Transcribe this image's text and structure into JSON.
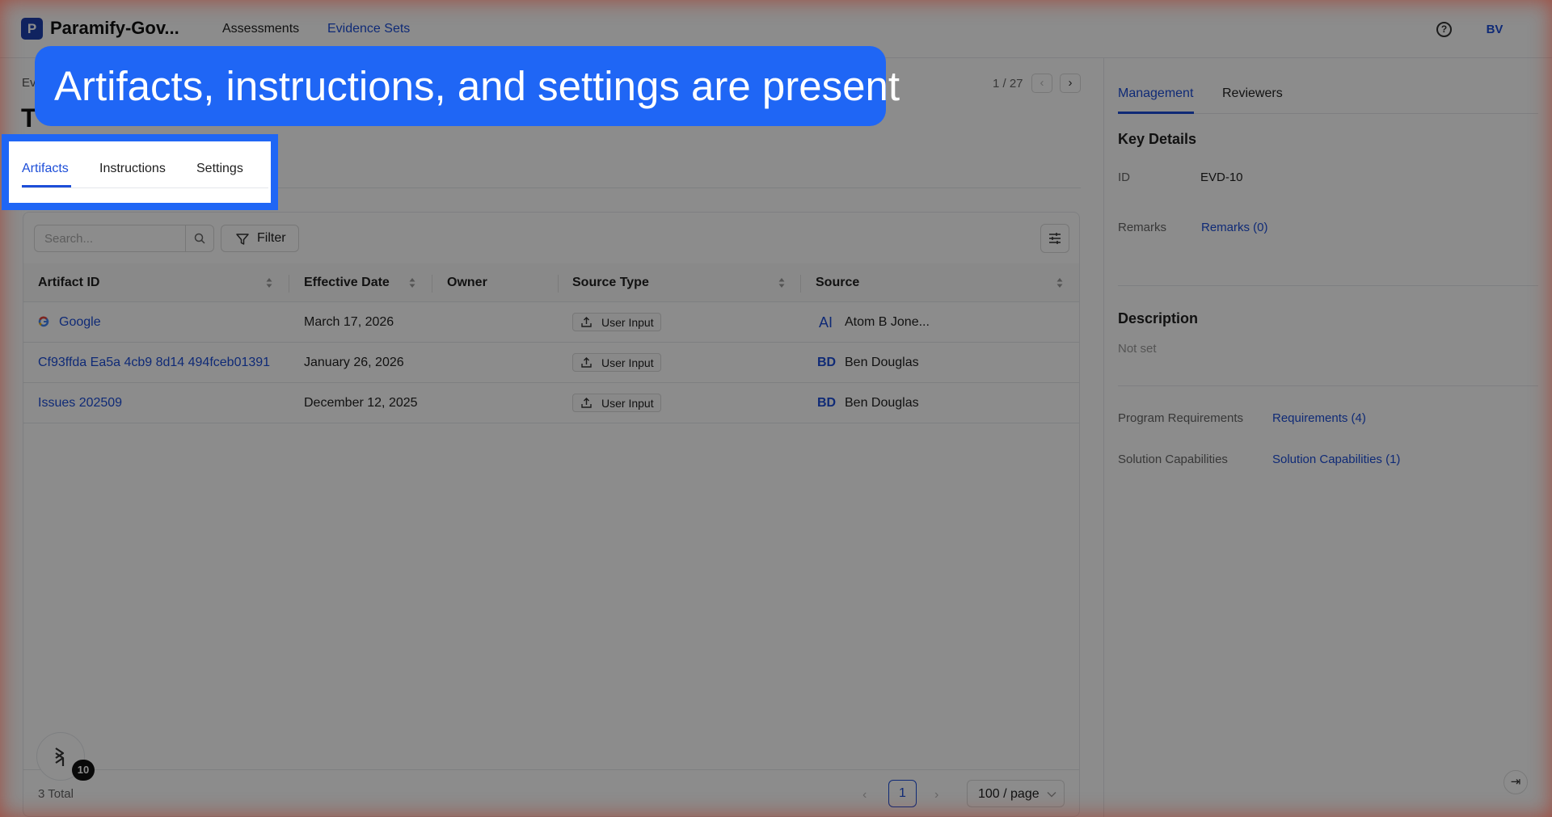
{
  "header": {
    "app_name": "Paramify-Gov...",
    "logo_glyph": "P",
    "nav": [
      "Assessments",
      "Evidence Sets"
    ],
    "help_glyph": "?",
    "avatar": "BV"
  },
  "page": {
    "breadcrumb": "Ev",
    "title": "T",
    "pager": "1 / 27",
    "prev_glyph": "‹",
    "next_glyph": "›"
  },
  "tabs": [
    "Artifacts",
    "Instructions",
    "Settings"
  ],
  "toolbar": {
    "search_placeholder": "Search...",
    "filter_label": "Filter"
  },
  "table": {
    "columns": [
      "Artifact ID",
      "Effective Date",
      "Owner",
      "Source Type",
      "Source"
    ],
    "rows": [
      {
        "id": "Google",
        "date": "March 17, 2026",
        "owner": "",
        "source_type": "User Input",
        "source_initials": "AI",
        "source": "Atom B Jone..."
      },
      {
        "id": "Cf93ffda Ea5a 4cb9 8d14 494fceb01391",
        "date": "January 26, 2026",
        "owner": "",
        "source_type": "User Input",
        "source_initials": "BD",
        "source": "Ben Douglas"
      },
      {
        "id": "Issues 202509",
        "date": "December 12, 2025",
        "owner": "",
        "source_type": "User Input",
        "source_initials": "BD",
        "source": "Ben Douglas"
      }
    ]
  },
  "footer": {
    "total": "3 Total",
    "current_page": "1",
    "page_size": "100 / page"
  },
  "float_badge": "10",
  "right_panel": {
    "tabs": [
      "Management",
      "Reviewers"
    ],
    "key_details_title": "Key Details",
    "id_label": "ID",
    "id_value": "EVD-10",
    "remarks_label": "Remarks",
    "remarks_link": "Remarks (0)",
    "description_title": "Description",
    "description_value": "Not set",
    "program_req_label": "Program Requirements",
    "program_req_link": "Requirements (4)",
    "solution_cap_label": "Solution Capabilities",
    "solution_cap_link": "Solution Capabilities (1)",
    "collapse_glyph": "⇥"
  },
  "overlay": {
    "callout_text": "Artifacts, instructions, and settings are present"
  },
  "colors": {
    "accent": "#1d4ed8",
    "callout": "#1f66f5"
  }
}
